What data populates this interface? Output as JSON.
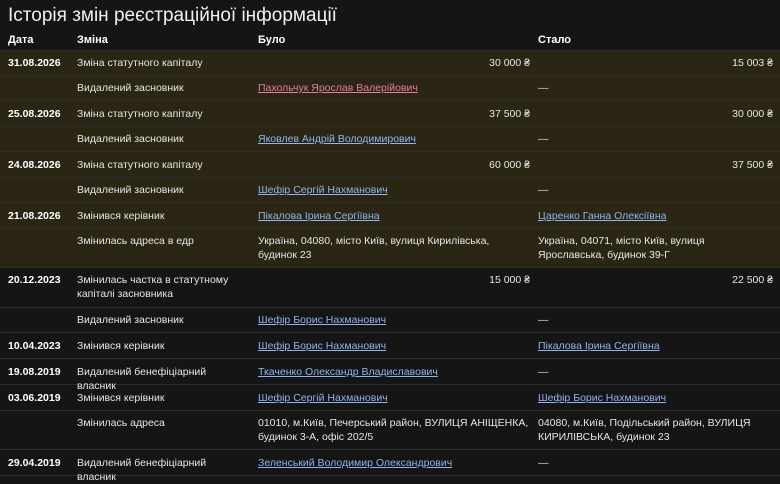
{
  "page": {
    "title": "Історія змін реєстраційної інформації"
  },
  "columns": {
    "date": "Дата",
    "change": "Зміна",
    "was": "Було",
    "now": "Стало"
  },
  "colors": {
    "highlight_bg": "#2a2613",
    "link": "#8fb4f0",
    "link_removed": "#e97aa3"
  },
  "rows": [
    {
      "date": "31.08.2026",
      "change": "Зміна статутного капіталу",
      "was": "30 000 ₴",
      "now": "15 003 ₴"
    },
    {
      "date": "",
      "change": "Видалений засновник",
      "was": "Пахольчук Ярослав Валерійович",
      "now": "—"
    },
    {
      "date": "25.08.2026",
      "change": "Зміна статутного капіталу",
      "was": "37 500 ₴",
      "now": "30 000 ₴"
    },
    {
      "date": "",
      "change": "Видалений засновник",
      "was": "Яковлев Андрій Володимирович",
      "now": "—"
    },
    {
      "date": "24.08.2026",
      "change": "Зміна статутного капіталу",
      "was": "60 000 ₴",
      "now": "37 500 ₴"
    },
    {
      "date": "",
      "change": "Видалений засновник",
      "was": "Шефір Сергій Нахманович",
      "now": "—"
    },
    {
      "date": "21.08.2026",
      "change": "Змінився керівник",
      "was": "Пікалова Ірина Сергіївна",
      "now": "Царенко Ганна Олексіївна"
    },
    {
      "date": "",
      "change": "Змінилась адреса в едр",
      "was": "Україна, 04080, місто Київ, вулиця Кирилівська, будинок 23",
      "now": "Україна, 04071, місто Київ, вулиця Ярославська, будинок 39-Г"
    },
    {
      "date": "20.12.2023",
      "change": "Змінилась частка в статутному капіталі засновника",
      "was": "15 000 ₴",
      "now": "22 500 ₴"
    },
    {
      "date": "",
      "change": "Видалений засновник",
      "was": "Шефір Борис Нахманович",
      "now": "—"
    },
    {
      "date": "10.04.2023",
      "change": "Змінився керівник",
      "was": "Шефір Борис Нахманович",
      "now": "Пікалова Ірина Сергіївна"
    },
    {
      "date": "19.08.2019",
      "change": "Видалений бенефіціарний власник",
      "was": "Ткаченко Олександр Владиславович",
      "now": "—"
    },
    {
      "date": "03.06.2019",
      "change": "Змінився керівник",
      "was": "Шефір Сергій Нахманович",
      "now": "Шефір Борис Нахманович"
    },
    {
      "date": "",
      "change": "Змінилась адреса",
      "was": "01010, м.Київ, Печерський район, ВУЛИЦЯ АНІЩЕНКА, будинок 3-А, офіс 202/5",
      "now": "04080, м.Київ, Подільський район, ВУЛИЦЯ КИРИЛІВСЬКА, будинок 23"
    },
    {
      "date": "29.04.2019",
      "change": "Видалений бенефіціарний власник",
      "was": "Зеленський Володимир Олександрович",
      "now": "—"
    }
  ]
}
